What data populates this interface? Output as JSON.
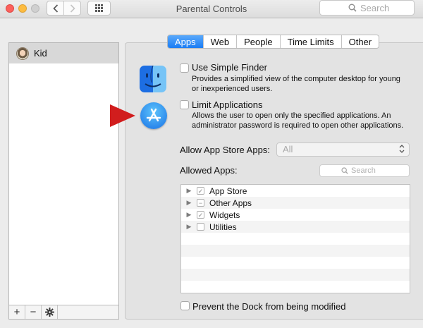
{
  "window": {
    "title": "Parental Controls",
    "search_placeholder": "Search"
  },
  "sidebar": {
    "users": [
      {
        "name": "Kid"
      }
    ],
    "footer": {
      "add": "+",
      "remove": "−",
      "gear": "✱"
    }
  },
  "tabs": [
    {
      "label": "Apps",
      "active": true
    },
    {
      "label": "Web",
      "active": false
    },
    {
      "label": "People",
      "active": false
    },
    {
      "label": "Time Limits",
      "active": false
    },
    {
      "label": "Other",
      "active": false
    }
  ],
  "options": {
    "simple_finder": {
      "title": "Use Simple Finder",
      "description_line1": "Provides a simplified view of the computer desktop for young",
      "description_line2": "or inexperienced users.",
      "checked": false
    },
    "limit_apps": {
      "title": "Limit Applications",
      "description_line1": "Allows the user to open only the specified applications. An",
      "description_line2": "administrator password is required to open other applications.",
      "checked": false
    }
  },
  "app_store_apps": {
    "label": "Allow App Store Apps:",
    "value": "All"
  },
  "allowed_apps": {
    "label": "Allowed Apps:",
    "search_placeholder": "Search",
    "items": [
      {
        "name": "App Store",
        "state": "✓"
      },
      {
        "name": "Other Apps",
        "state": "−"
      },
      {
        "name": "Widgets",
        "state": "✓"
      },
      {
        "name": "Utilities",
        "state": ""
      }
    ]
  },
  "prevent_dock": {
    "label": "Prevent the Dock from being modified",
    "checked": false
  },
  "colors": {
    "accent": "#1a7cf4",
    "arrow": "#d11d1d"
  },
  "icons": {
    "back": "chevron-left-icon",
    "forward": "chevron-right-icon",
    "grid": "grid-icon",
    "search": "search-icon",
    "finder": "finder-icon",
    "app_store": "app-store-icon"
  }
}
